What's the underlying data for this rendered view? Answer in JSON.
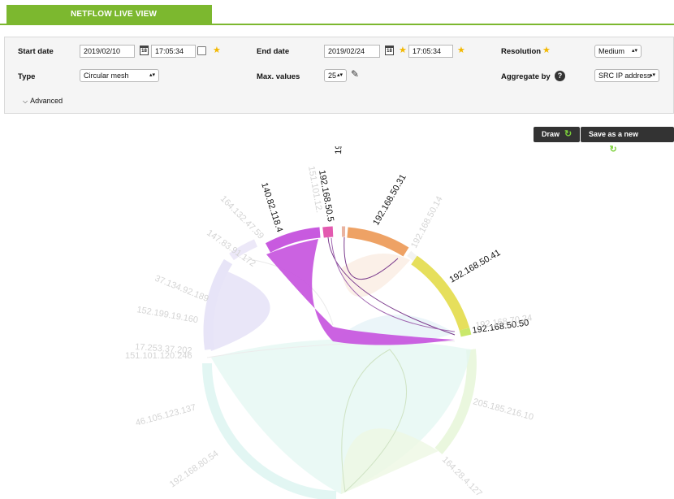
{
  "tab": {
    "label": "NETFLOW LIVE VIEW"
  },
  "filters": {
    "start_date": {
      "label": "Start date",
      "date": "2019/02/10",
      "time": "17:05:34"
    },
    "end_date": {
      "label": "End date",
      "date": "2019/02/24",
      "time": "17:05:34"
    },
    "resolution": {
      "label": "Resolution",
      "value": "Medium"
    },
    "type": {
      "label": "Type",
      "value": "Circular mesh"
    },
    "max_values": {
      "label": "Max. values",
      "value": "25"
    },
    "aggregate_by": {
      "label": "Aggregate by",
      "value": "SRC IP address"
    },
    "advanced_label": "Advanced",
    "calendar_glyph": "18"
  },
  "buttons": {
    "draw": "Draw",
    "save_filter": "Save as a new filter"
  },
  "icons": [
    "calendar-icon",
    "star-icon",
    "help-icon",
    "pencil-icon",
    "refresh-icon",
    "chevron-down-icon"
  ],
  "colors": {
    "accent": "#7cb82f",
    "magenta": "#c85adf",
    "orange": "#eea265",
    "yellow": "#e6df5c",
    "lime": "#c9e86b",
    "pink": "#e35ab0"
  },
  "chart_data": {
    "type": "chord",
    "highlighted_nodes": [
      "140.82.118.4",
      "192.168.50.5",
      "192.168.70.147",
      "192.168.50.31",
      "192.168.50.41",
      "192.168.50.50"
    ],
    "faded_nodes": [
      "151.101.12.",
      "164.132.47.59",
      "147.83.91.172",
      "37.134.92.189",
      "152.199.19.160",
      "17.253.37.202",
      "151.101.120.246",
      "46.105.123.137",
      "192.168.80.54",
      "192.168.50.14",
      "192.168.70.24",
      "205.185.216.10",
      "164.28.4.127"
    ]
  }
}
